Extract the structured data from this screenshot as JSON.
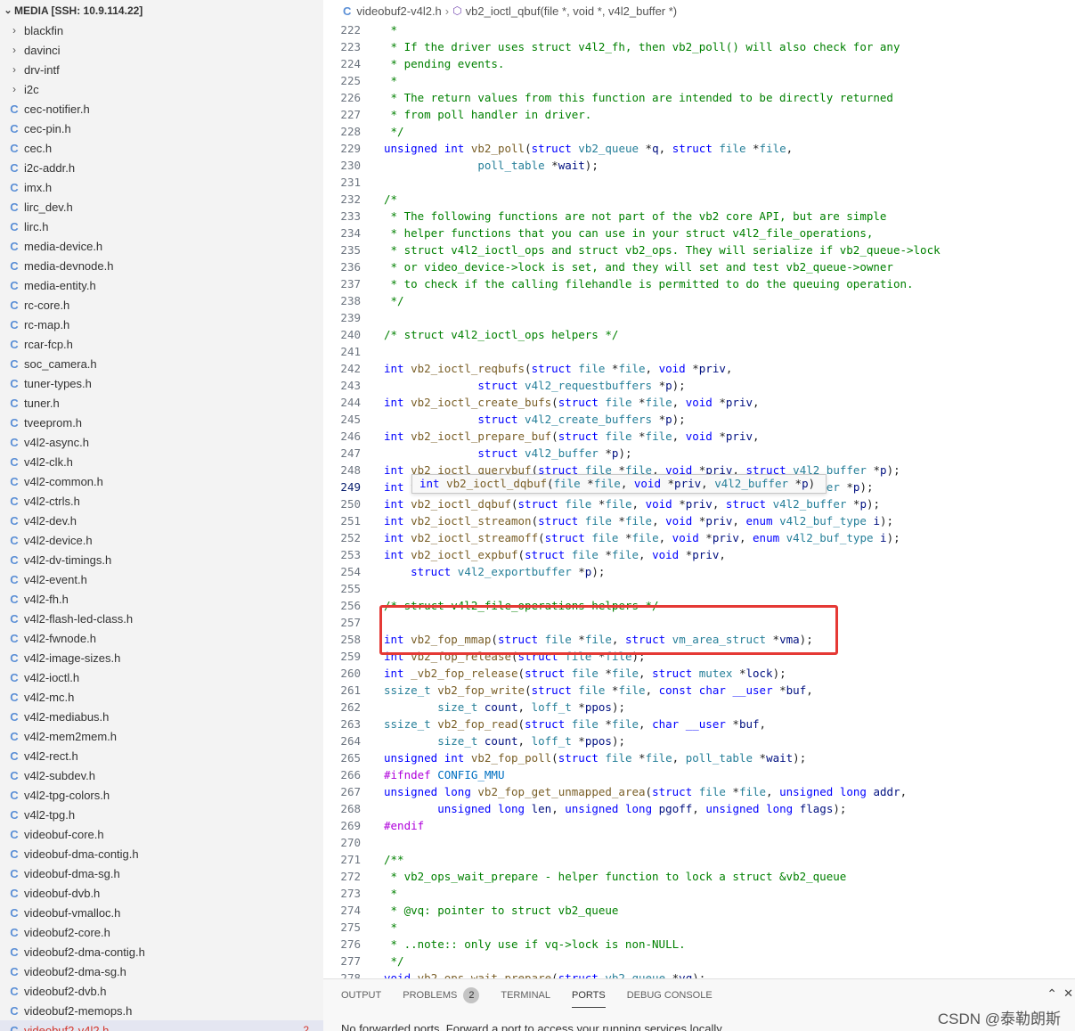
{
  "sidebar": {
    "section_title": "MEDIA [SSH: 10.9.114.22]",
    "folders": [
      "blackfin",
      "davinci",
      "drv-intf",
      "i2c"
    ],
    "files": [
      "cec-notifier.h",
      "cec-pin.h",
      "cec.h",
      "i2c-addr.h",
      "imx.h",
      "lirc_dev.h",
      "lirc.h",
      "media-device.h",
      "media-devnode.h",
      "media-entity.h",
      "rc-core.h",
      "rc-map.h",
      "rcar-fcp.h",
      "soc_camera.h",
      "tuner-types.h",
      "tuner.h",
      "tveeprom.h",
      "v4l2-async.h",
      "v4l2-clk.h",
      "v4l2-common.h",
      "v4l2-ctrls.h",
      "v4l2-dev.h",
      "v4l2-device.h",
      "v4l2-dv-timings.h",
      "v4l2-event.h",
      "v4l2-fh.h",
      "v4l2-flash-led-class.h",
      "v4l2-fwnode.h",
      "v4l2-image-sizes.h",
      "v4l2-ioctl.h",
      "v4l2-mc.h",
      "v4l2-mediabus.h",
      "v4l2-mem2mem.h",
      "v4l2-rect.h",
      "v4l2-subdev.h",
      "v4l2-tpg-colors.h",
      "v4l2-tpg.h",
      "videobuf-core.h",
      "videobuf-dma-contig.h",
      "videobuf-dma-sg.h",
      "videobuf-dvb.h",
      "videobuf-vmalloc.h",
      "videobuf2-core.h",
      "videobuf2-dma-contig.h",
      "videobuf2-dma-sg.h",
      "videobuf2-dvb.h",
      "videobuf2-memops.h",
      "videobuf2-v4l2.h"
    ],
    "active_file_problems": "2",
    "file_icon": "C"
  },
  "breadcrumb": {
    "file": "videobuf2-v4l2.h",
    "symbol": "vb2_ioctl_qbuf(file *, void *, v4l2_buffer *)",
    "symbol_icon": "cube-icon"
  },
  "editor": {
    "current_line": "249",
    "hover_tip": "int vb2_ioctl_dqbuf(file *file, void *priv, v4l2_buffer *p)",
    "lines": [
      {
        "n": "222",
        "t": " *"
      },
      {
        "n": "223",
        "t": " * If the driver uses struct v4l2_fh, then vb2_poll() will also check for any"
      },
      {
        "n": "224",
        "t": " * pending events."
      },
      {
        "n": "225",
        "t": " *"
      },
      {
        "n": "226",
        "t": " * The return values from this function are intended to be directly returned"
      },
      {
        "n": "227",
        "t": " * from poll handler in driver."
      },
      {
        "n": "228",
        "t": " */"
      },
      {
        "n": "229",
        "t": "unsigned int vb2_poll(struct vb2_queue *q, struct file *file,"
      },
      {
        "n": "230",
        "t": "              poll_table *wait);"
      },
      {
        "n": "231",
        "t": ""
      },
      {
        "n": "232",
        "t": "/*"
      },
      {
        "n": "233",
        "t": " * The following functions are not part of the vb2 core API, but are simple"
      },
      {
        "n": "234",
        "t": " * helper functions that you can use in your struct v4l2_file_operations,"
      },
      {
        "n": "235",
        "t": " * struct v4l2_ioctl_ops and struct vb2_ops. They will serialize if vb2_queue->lock"
      },
      {
        "n": "236",
        "t": " * or video_device->lock is set, and they will set and test vb2_queue->owner"
      },
      {
        "n": "237",
        "t": " * to check if the calling filehandle is permitted to do the queuing operation."
      },
      {
        "n": "238",
        "t": " */"
      },
      {
        "n": "239",
        "t": ""
      },
      {
        "n": "240",
        "t": "/* struct v4l2_ioctl_ops helpers */"
      },
      {
        "n": "241",
        "t": ""
      },
      {
        "n": "242",
        "t": "int vb2_ioctl_reqbufs(struct file *file, void *priv,"
      },
      {
        "n": "243",
        "t": "              struct v4l2_requestbuffers *p);"
      },
      {
        "n": "244",
        "t": "int vb2_ioctl_create_bufs(struct file *file, void *priv,"
      },
      {
        "n": "245",
        "t": "              struct v4l2_create_buffers *p);"
      },
      {
        "n": "246",
        "t": "int vb2_ioctl_prepare_buf(struct file *file, void *priv,"
      },
      {
        "n": "247",
        "t": "              struct v4l2_buffer *p);"
      },
      {
        "n": "248",
        "t": "int vb2_ioctl_querybuf(struct file *file, void *priv, struct v4l2_buffer *p);"
      },
      {
        "n": "249",
        "t": "int vb2_ioctl_qbuf(struct file *file, void *priv, struct v4l2_buffer *p);"
      },
      {
        "n": "250",
        "t": "int vb2_ioctl_dqbuf(struct file *file, void *priv, struct v4l2_buffer *p);"
      },
      {
        "n": "251",
        "t": "int vb2_ioctl_streamon(struct file *file, void *priv, enum v4l2_buf_type i);"
      },
      {
        "n": "252",
        "t": "int vb2_ioctl_streamoff(struct file *file, void *priv, enum v4l2_buf_type i);"
      },
      {
        "n": "253",
        "t": "int vb2_ioctl_expbuf(struct file *file, void *priv,"
      },
      {
        "n": "254",
        "t": "    struct v4l2_exportbuffer *p);"
      },
      {
        "n": "255",
        "t": ""
      },
      {
        "n": "256",
        "t": "/* struct v4l2_file_operations helpers */"
      },
      {
        "n": "257",
        "t": ""
      },
      {
        "n": "258",
        "t": "int vb2_fop_mmap(struct file *file, struct vm_area_struct *vma);"
      },
      {
        "n": "259",
        "t": "int vb2_fop_release(struct file *file);"
      },
      {
        "n": "260",
        "t": "int _vb2_fop_release(struct file *file, struct mutex *lock);"
      },
      {
        "n": "261",
        "t": "ssize_t vb2_fop_write(struct file *file, const char __user *buf,"
      },
      {
        "n": "262",
        "t": "        size_t count, loff_t *ppos);"
      },
      {
        "n": "263",
        "t": "ssize_t vb2_fop_read(struct file *file, char __user *buf,"
      },
      {
        "n": "264",
        "t": "        size_t count, loff_t *ppos);"
      },
      {
        "n": "265",
        "t": "unsigned int vb2_fop_poll(struct file *file, poll_table *wait);"
      },
      {
        "n": "266",
        "t": "#ifndef CONFIG_MMU"
      },
      {
        "n": "267",
        "t": "unsigned long vb2_fop_get_unmapped_area(struct file *file, unsigned long addr,"
      },
      {
        "n": "268",
        "t": "        unsigned long len, unsigned long pgoff, unsigned long flags);"
      },
      {
        "n": "269",
        "t": "#endif"
      },
      {
        "n": "270",
        "t": ""
      },
      {
        "n": "271",
        "t": "/**"
      },
      {
        "n": "272",
        "t": " * vb2_ops_wait_prepare - helper function to lock a struct &vb2_queue"
      },
      {
        "n": "273",
        "t": " *"
      },
      {
        "n": "274",
        "t": " * @vq: pointer to struct vb2_queue"
      },
      {
        "n": "275",
        "t": " *"
      },
      {
        "n": "276",
        "t": " * ..note:: only use if vq->lock is non-NULL."
      },
      {
        "n": "277",
        "t": " */"
      },
      {
        "n": "278",
        "t": "void vb2_ops_wait_prepare(struct vb2_queue *vq);"
      }
    ]
  },
  "panel": {
    "tabs": [
      "OUTPUT",
      "PROBLEMS",
      "TERMINAL",
      "PORTS",
      "DEBUG CONSOLE"
    ],
    "active_tab": "PORTS",
    "problems_count": "2",
    "message": "No forwarded ports. Forward a port to access your running services locally."
  },
  "watermark": "CSDN @泰勒朗斯",
  "colors": {
    "highlight_box": "#e53935",
    "keyword": "#0000ff",
    "type": "#267f99",
    "function": "#795e26",
    "comment": "#008000",
    "param": "#001080"
  }
}
